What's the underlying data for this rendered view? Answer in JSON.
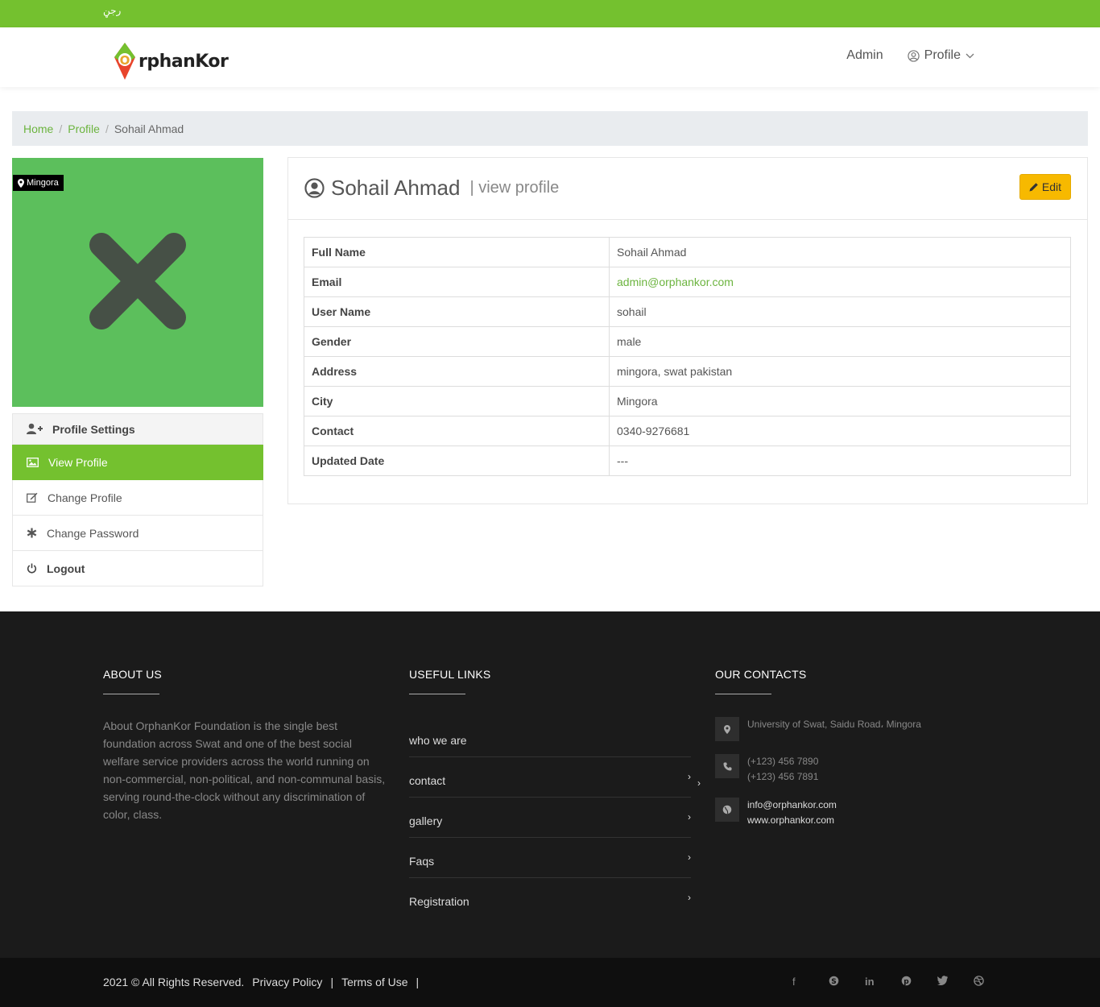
{
  "topbar": {
    "language": "رجڼ"
  },
  "brand": {
    "logo_letter": "O",
    "name": "rphanKor"
  },
  "nav": {
    "admin": "Admin",
    "profile": "Profile"
  },
  "breadcrumb": {
    "home": "Home",
    "profile": "Profile",
    "current": "Sohail Ahmad"
  },
  "photo": {
    "location": "Mingora"
  },
  "sidebar": {
    "items": [
      {
        "label": "Profile Settings",
        "icon": "user-plus-icon"
      },
      {
        "label": "View Profile",
        "icon": "image-icon"
      },
      {
        "label": "Change Profile",
        "icon": "edit-icon"
      },
      {
        "label": "Change Password",
        "icon": "asterisk-icon"
      },
      {
        "label": "Logout",
        "icon": "power-icon"
      }
    ]
  },
  "panel": {
    "name": "Sohail Ahmad",
    "subtitle": "| view profile",
    "edit_label": "Edit",
    "rows": [
      {
        "key": "Full Name",
        "value": "Sohail Ahmad"
      },
      {
        "key": "Email",
        "value": "admin@orphankor.com"
      },
      {
        "key": "User Name",
        "value": "sohail"
      },
      {
        "key": "Gender",
        "value": "male"
      },
      {
        "key": "Address",
        "value": "mingora, swat pakistan"
      },
      {
        "key": "City",
        "value": "Mingora"
      },
      {
        "key": "Contact",
        "value": "0340-9276681"
      },
      {
        "key": "Updated Date",
        "value": "---"
      }
    ]
  },
  "footer": {
    "about": {
      "title": "ABOUT US",
      "text": "About OrphanKor Foundation is the single best foundation across Swat and one of the best social welfare service providers across the world running on non-commercial, non-political, and non-communal basis, serving round-the-clock without any discrimination of color, class."
    },
    "links": {
      "title": "USEFUL LINKS",
      "items": [
        "who we are",
        "contact",
        "gallery",
        "Faqs",
        "Registration"
      ]
    },
    "contacts": {
      "title": "OUR CONTACTS",
      "address": "University of Swat, Saidu Road، Mingora",
      "phone1": "(+123) 456 7890",
      "phone2": "(+123) 456 7891",
      "email": "info@orphankor.com",
      "website": "www.orphankor.com"
    }
  },
  "bottom": {
    "copyright": "2021 © All Rights Reserved.",
    "privacy": "Privacy Policy",
    "sep": "|",
    "terms": "Terms of Use",
    "sep2": "|"
  },
  "colors": {
    "brand_green": "#74c12f",
    "edit_yellow": "#f7b900",
    "footer_bg": "#1b1b1b"
  }
}
